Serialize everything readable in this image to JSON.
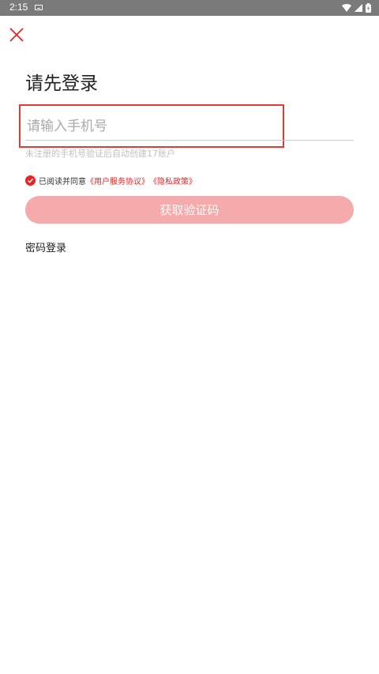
{
  "status_bar": {
    "time": "2:15",
    "icons": [
      "keyboard-icon",
      "wifi-icon",
      "signal-icon",
      "battery-icon"
    ]
  },
  "header": {
    "close_icon": "close-icon",
    "title": "请先登录"
  },
  "login_form": {
    "phone_placeholder": "请输入手机号",
    "phone_value": "",
    "hint": "未注册的手机号验证后自动创建17账户",
    "agree_prefix": "已阅读并同意",
    "user_agreement": "《用户服务协议》",
    "privacy_policy": "《隐私政策》",
    "get_code_label": "获取验证码",
    "password_login_label": "密码登录"
  },
  "colors": {
    "accent": "#e52525",
    "button_disabled": "#f5abab",
    "highlight_border": "#e53935",
    "status_bar": "#7a7a7a"
  }
}
